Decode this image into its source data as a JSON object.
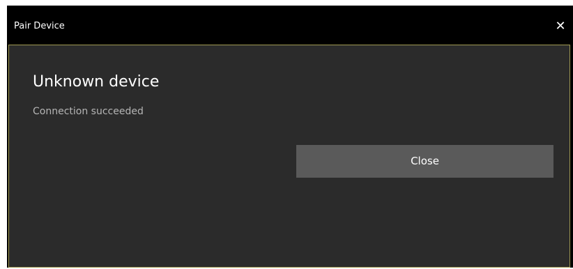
{
  "window": {
    "title": "Pair Device",
    "close_glyph": "✕"
  },
  "dialog": {
    "heading": "Unknown device",
    "status": "Connection succeeded",
    "close_button_label": "Close"
  },
  "colors": {
    "titlebar_bg": "#000000",
    "content_bg": "#2b2b2b",
    "accent_border": "#a09a52",
    "button_bg": "#5a5a5a"
  }
}
